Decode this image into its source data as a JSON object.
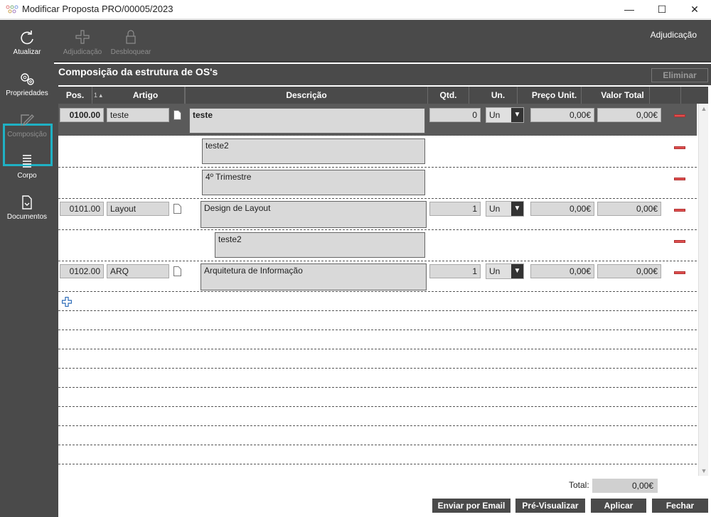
{
  "window": {
    "title": "Modificar Proposta PRO/00005/2023",
    "min": "—",
    "max": "☐",
    "close": "✕"
  },
  "sidebar": [
    {
      "label": "Atualizar",
      "icon": "refresh-icon"
    },
    {
      "label": "Propriedades",
      "icon": "gears-icon"
    },
    {
      "label": "Composição",
      "icon": "edit-icon",
      "selected": true
    },
    {
      "label": "Corpo",
      "icon": "lines-icon"
    },
    {
      "label": "Documentos",
      "icon": "documents-icon"
    }
  ],
  "toolbar": {
    "adjudicacao": "Adjudicação",
    "desbloquear": "Desbloquear",
    "right_label": "Adjudicação"
  },
  "section": {
    "title": "Composição da estrutura de OS's",
    "eliminar": "Eliminar"
  },
  "columns": {
    "pos": "Pos.",
    "sort": "1 ▴",
    "artigo": "Artigo",
    "descricao": "Descrição",
    "qtd": "Qtd.",
    "un": "Un.",
    "preco": "Preço Unit.",
    "valor": "Valor Total"
  },
  "rows": [
    {
      "pos": "0100.00",
      "artigo": "teste",
      "descricao": "teste",
      "qtd": "0",
      "un": "Un",
      "preco": "0,00€",
      "valor": "0,00€"
    },
    {
      "descricao": "teste2"
    },
    {
      "descricao": "4º Trimestre"
    },
    {
      "pos": "0101.00",
      "artigo": "Layout",
      "descricao": "Design de Layout",
      "qtd": "1",
      "un": "Un",
      "preco": "0,00€",
      "valor": "0,00€"
    },
    {
      "descricao": "teste2"
    },
    {
      "pos": "0102.00",
      "artigo": "ARQ",
      "descricao": "Arquitetura de Informação",
      "qtd": "1",
      "un": "Un",
      "preco": "0,00€",
      "valor": "0,00€"
    }
  ],
  "footer": {
    "total_label": "Total:",
    "total_value": "0,00€",
    "email": "Enviar por Email",
    "preview": "Pré-Visualizar",
    "apply": "Aplicar",
    "close": "Fechar"
  },
  "colors": {
    "dark": "#4a4a4a",
    "accent": "#1fb1c4",
    "delete": "#e05050"
  }
}
